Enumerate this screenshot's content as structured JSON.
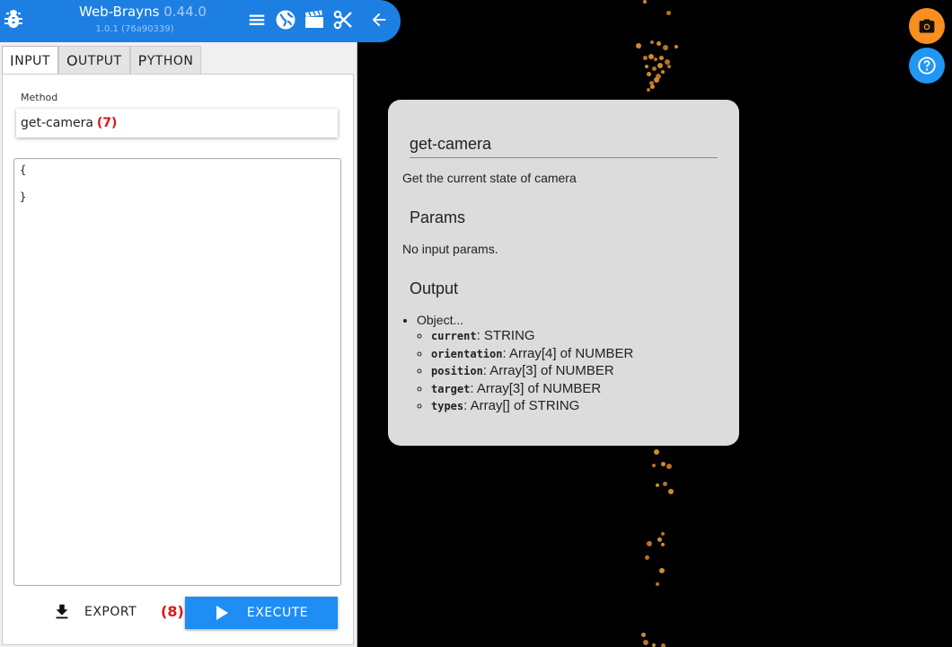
{
  "header": {
    "app_name": "Web-Brayns",
    "app_version": "0.44.0",
    "build": "1.0.1 (76a90339)"
  },
  "tabs": [
    {
      "label_cap": "I",
      "label_rest": "NPUT"
    },
    {
      "label_cap": "O",
      "label_rest": "UTPUT"
    },
    {
      "label_cap": "P",
      "label_rest": "YTHON"
    }
  ],
  "method": {
    "label": "Method",
    "value": "get-camera",
    "step": "(7)"
  },
  "editor": {
    "lines": [
      "{",
      "}"
    ]
  },
  "actions": {
    "export_label": "EXPORT",
    "execute_label": "EXECUTE",
    "step": "(8)"
  },
  "doc": {
    "title": "get-camera",
    "description": "Get the current state of camera",
    "params_heading": "Params",
    "params_text": "No input params.",
    "output_heading": "Output",
    "output_type": "Object...",
    "fields": [
      {
        "name": "current",
        "type": ": STRING"
      },
      {
        "name": "orientation",
        "type": ": Array[4] of NUMBER"
      },
      {
        "name": "position",
        "type": ": Array[3] of NUMBER"
      },
      {
        "name": "target",
        "type": ": Array[3] of NUMBER"
      },
      {
        "name": "types",
        "type": ": Array[] of STRING"
      }
    ]
  },
  "icons": {
    "header": [
      "bug-icon",
      "menu-icon",
      "globe-icon",
      "clapperboard-icon",
      "scissors-icon",
      "arrow-left-icon"
    ],
    "fabs": [
      "camera-icon",
      "help-icon"
    ],
    "actions": [
      "download-icon",
      "play-icon"
    ]
  },
  "colors": {
    "header_bg": "#1e7fe3",
    "execute_bg": "#1e8ef4",
    "camera_fab": "#f7901e",
    "help_fab": "#2196f3",
    "step_marker": "#e01515",
    "doc_card_bg": "#dcdcdc"
  }
}
